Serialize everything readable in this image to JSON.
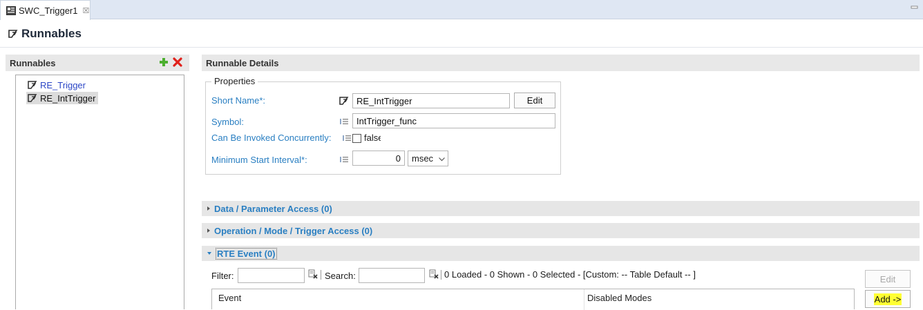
{
  "tab": {
    "title": "SWC_Trigger1",
    "close_symbol": "☒"
  },
  "page": {
    "title": "Runnables"
  },
  "left_panel": {
    "header": "Runnables",
    "items": [
      {
        "label": "RE_Trigger",
        "selected": false
      },
      {
        "label": "RE_IntTrigger",
        "selected": true
      }
    ]
  },
  "details": {
    "header": "Runnable Details",
    "group_title": "Properties",
    "short_name": {
      "label": "Short Name*:",
      "value": "RE_IntTrigger"
    },
    "edit_label": "Edit",
    "symbol": {
      "label": "Symbol:",
      "value": "IntTrigger_func"
    },
    "concurrent": {
      "label": "Can Be Invoked Concurrently:",
      "value": "false",
      "checked": false
    },
    "min_interval": {
      "label": "Minimum Start Interval*:",
      "value": "0",
      "unit": "msec"
    }
  },
  "sections": {
    "data_access": "Data / Parameter Access (0)",
    "operation_access": "Operation / Mode / Trigger Access (0)",
    "rte_event": "RTE Event (0)"
  },
  "rte_table": {
    "filter_label": "Filter:",
    "filter_value": "",
    "search_label": "Search:",
    "search_value": "",
    "status": "0 Loaded - 0 Shown - 0 Selected -  [Custom: -- Table Default -- ]",
    "columns": [
      "Event",
      "Disabled Modes"
    ],
    "edit_button": "Edit",
    "add_button": "Add ->"
  },
  "colors": {
    "link": "#2a7fc2",
    "header_bg": "#e8e8e8",
    "highlight": "#ffff33"
  }
}
